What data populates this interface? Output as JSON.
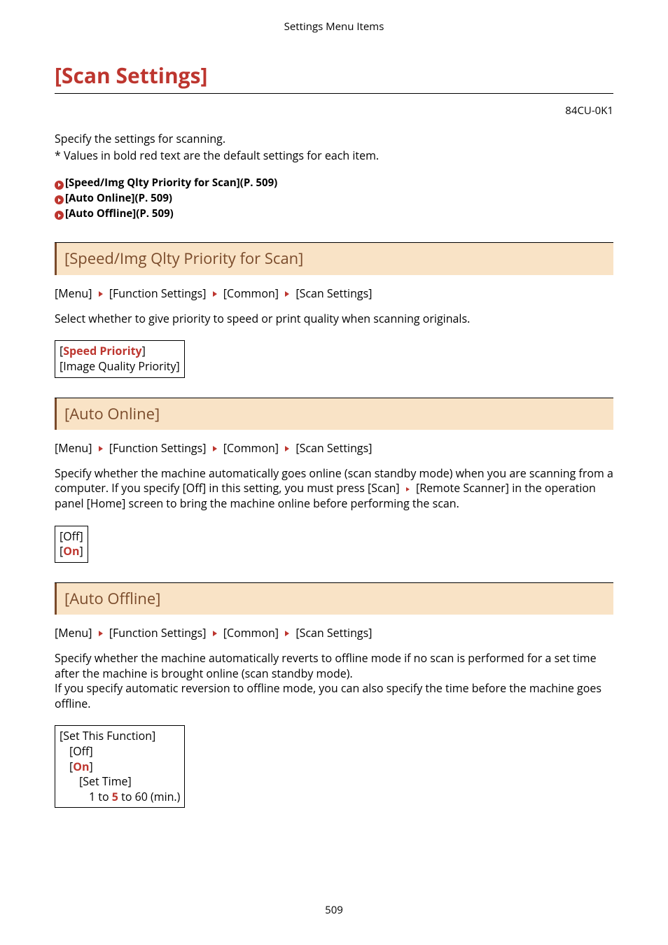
{
  "header": "Settings Menu Items",
  "title": "[Scan Settings]",
  "doc_id": "84CU-0K1",
  "intro": {
    "line1": "Specify the settings for scanning.",
    "line2": "* Values in bold red text are the default settings for each item."
  },
  "toc": {
    "item1": "[Speed/Img Qlty Priority for Scan](P. 509)",
    "item2": "[Auto Online](P. 509)",
    "item3": "[Auto Offline](P. 509)"
  },
  "breadcrumb": {
    "p1": "[Menu]",
    "p2": "[Function Settings]",
    "p3": "[Common]",
    "p4": "[Scan Settings]"
  },
  "sections": {
    "speed": {
      "heading": "[Speed/Img Qlty Priority for Scan]",
      "para": "Select whether to give priority to speed or print quality when scanning originals.",
      "opt_default_l": "[",
      "opt_default": "Speed Priority",
      "opt_default_r": "]",
      "opt_other": "[Image Quality Priority]"
    },
    "online": {
      "heading": "[Auto Online]",
      "para_pre": "Specify whether the machine automatically goes online (scan standby mode) when you are scanning from a computer. If you specify [Off] in this setting, you must press [Scan] ",
      "para_post": " [Remote Scanner] in the operation panel [Home] screen to bring the machine online before performing the scan.",
      "opt_off": "[Off]",
      "opt_on_l": "[",
      "opt_on": "On",
      "opt_on_r": "]"
    },
    "offline": {
      "heading": "[Auto Offline]",
      "para1": "Specify whether the machine automatically reverts to offline mode if no scan is performed for a set time after the machine is brought online (scan standby mode).",
      "para2": "If you specify automatic reversion to offline mode, you can also specify the time before the machine goes offline.",
      "box": {
        "set_this": "[Set This Function]",
        "off": "[Off]",
        "on_l": "[",
        "on": "On",
        "on_r": "]",
        "set_time": "[Set Time]",
        "range_pre": "1 to ",
        "range_default": "5",
        "range_post": " to 60 (min.)"
      }
    }
  },
  "footer": "509"
}
